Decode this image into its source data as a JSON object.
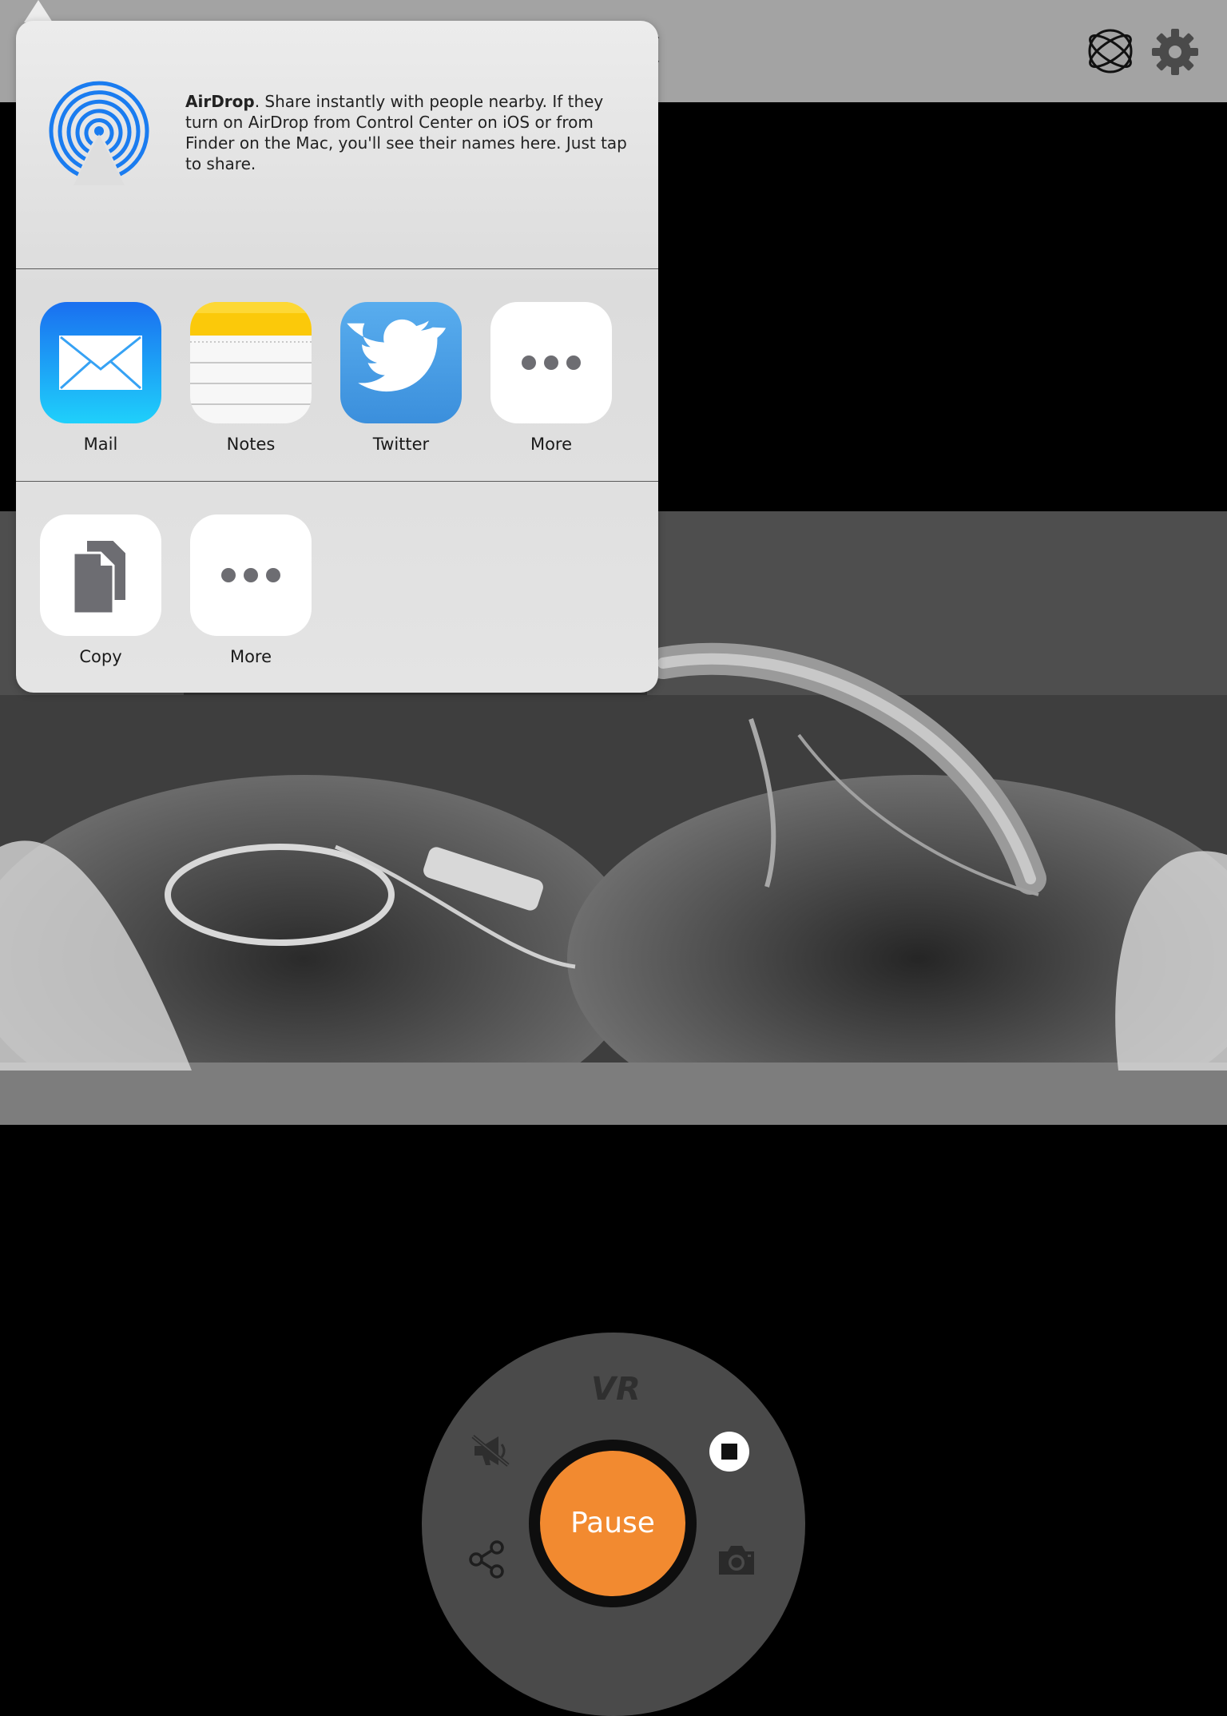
{
  "topbar": {
    "back_icon": "chevron-left-icon",
    "orbit_icon": "atom-orbit-icon",
    "settings_icon": "gear-icon"
  },
  "share_sheet": {
    "airdrop": {
      "title": "AirDrop",
      "description": ". Share instantly with people nearby. If they turn on AirDrop from Control Center on iOS or from Finder on the Mac, you'll see their names here. Just tap to share."
    },
    "apps": [
      {
        "label": "Mail",
        "icon": "mail-icon"
      },
      {
        "label": "Notes",
        "icon": "notes-icon"
      },
      {
        "label": "Twitter",
        "icon": "twitter-icon"
      },
      {
        "label": "More",
        "icon": "more-dots-icon"
      }
    ],
    "actions": [
      {
        "label": "Copy",
        "icon": "copy-icon"
      },
      {
        "label": "More",
        "icon": "more-dots-icon"
      }
    ]
  },
  "controls": {
    "mode_label": "VR",
    "pause_label": "Pause",
    "mute_icon": "megaphone-muted-icon",
    "stop_icon": "stop-icon",
    "share_icon": "share-icon",
    "camera_icon": "camera-icon"
  },
  "colors": {
    "accent": "#f28a30",
    "mail_blue": "#1a6ff0",
    "twitter_blue": "#55acee",
    "airdrop_blue": "#1a7cf0"
  }
}
